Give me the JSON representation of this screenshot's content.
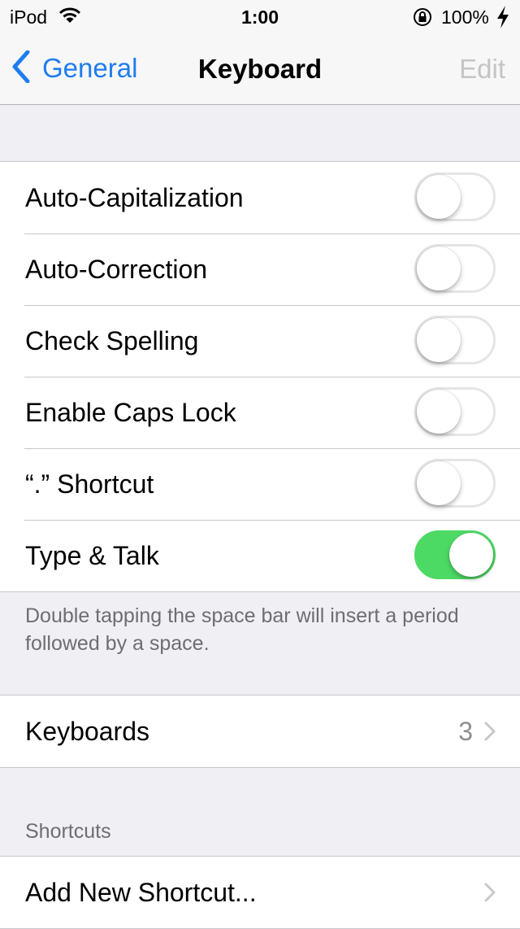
{
  "status": {
    "carrier": "iPod",
    "time": "1:00",
    "battery": "100%"
  },
  "nav": {
    "back_label": "General",
    "title": "Keyboard",
    "edit_label": "Edit"
  },
  "toggles": [
    {
      "label": "Auto-Capitalization",
      "on": false
    },
    {
      "label": "Auto-Correction",
      "on": false
    },
    {
      "label": "Check Spelling",
      "on": false
    },
    {
      "label": "Enable Caps Lock",
      "on": false
    },
    {
      "label": "“.” Shortcut",
      "on": false
    },
    {
      "label": "Type & Talk",
      "on": true
    }
  ],
  "toggle_footer": "Double tapping the space bar will insert a period followed by a space.",
  "keyboards": {
    "label": "Keyboards",
    "count": "3"
  },
  "shortcuts": {
    "header": "Shortcuts",
    "add_label": "Add New Shortcut..."
  },
  "colors": {
    "tint": "#1f7cf0",
    "toggle_on": "#4cd964",
    "background": "#efeff4"
  }
}
